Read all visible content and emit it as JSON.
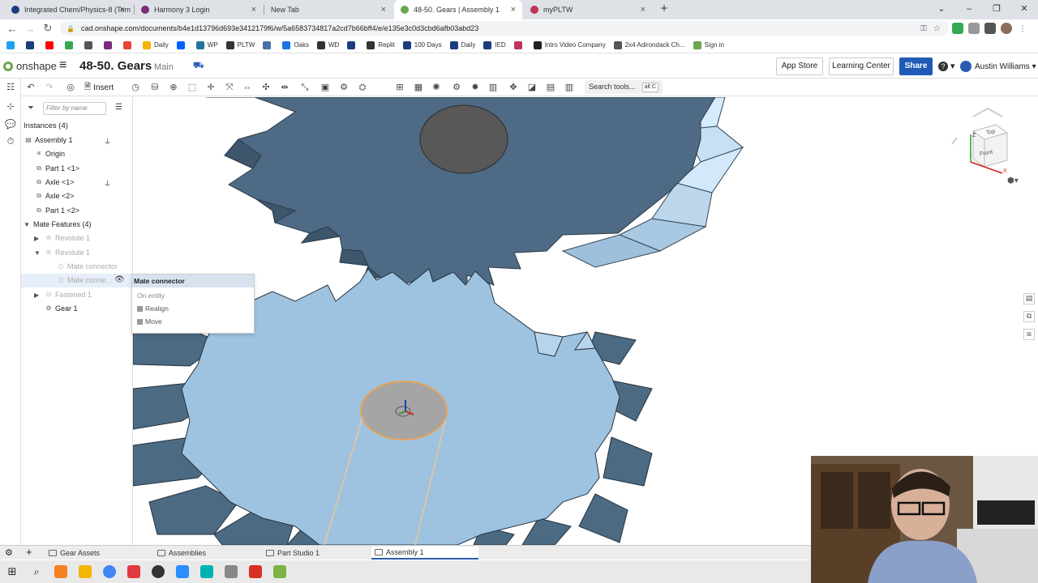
{
  "browser": {
    "tabs": [
      {
        "title": "Integrated Chem/Physics-8 (Tem",
        "color": "#1a3d7c"
      },
      {
        "title": "Harmony 3 Login",
        "color": "#7a2b7c"
      },
      {
        "title": "New Tab",
        "color": ""
      },
      {
        "title": "48-50. Gears | Assembly 1",
        "color": "#6aa84f"
      },
      {
        "title": "myPLTW",
        "color": "#c0335a"
      }
    ],
    "new_tab": "+",
    "url": "cad.onshape.com/documents/b4e1d13796d693e3412179f6/w/5a6583734817a2cd7b66bff4/e/e135e3c0d3cbd6afb03abd23"
  },
  "bookmarks": [
    {
      "label": "",
      "color": "#1da1f2"
    },
    {
      "label": "",
      "color": "#1a3d7c"
    },
    {
      "label": "",
      "color": "#ff0000"
    },
    {
      "label": "",
      "color": "#34a853"
    },
    {
      "label": "",
      "color": "#555555"
    },
    {
      "label": "",
      "color": "#7a2b7c"
    },
    {
      "label": "",
      "color": "#ea4335"
    },
    {
      "label": "Daily",
      "color": "#f4b400"
    },
    {
      "label": "",
      "color": "#0061ff"
    },
    {
      "label": "WP",
      "color": "#21759b"
    },
    {
      "label": "PLTW",
      "color": "#333333"
    },
    {
      "label": "",
      "color": "#4a6fa5"
    },
    {
      "label": "Oaks",
      "color": "#1a73e8"
    },
    {
      "label": "WD",
      "color": "#333333"
    },
    {
      "label": "",
      "color": "#1a3d7c"
    },
    {
      "label": "Replit",
      "color": "#333333"
    },
    {
      "label": "100 Days",
      "color": "#1a3d7c"
    },
    {
      "label": "Daily",
      "color": "#1a3d7c"
    },
    {
      "label": "IED",
      "color": "#1a3d7c"
    },
    {
      "label": "",
      "color": "#c0335a"
    },
    {
      "label": "Intro Video Company",
      "color": "#222222"
    },
    {
      "label": "2x4 Adirondack Ch...",
      "color": "#555555"
    },
    {
      "label": "Sign in",
      "color": "#6aa84f"
    }
  ],
  "onshape": {
    "logo": "onshape",
    "doc_title": "48-50. Gears",
    "branch": "Main",
    "app_store": "App Store",
    "learning_center": "Learning Center",
    "share": "Share",
    "help": "?",
    "user": "Austin Williams"
  },
  "toolbar": {
    "insert": "Insert",
    "search_placeholder": "Search tools...",
    "search_shortcut": "alt C"
  },
  "panel": {
    "filter_placeholder": "Filter by name",
    "instances_header": "Instances (4)",
    "assembly": "Assembly 1",
    "origin": "Origin",
    "items": [
      "Part 1 <1>",
      "Axle <1>",
      "Axle <2>",
      "Part 1 <2>"
    ],
    "mate_features": "Mate Features (4)",
    "revolute1": "Revolute 1",
    "revolute2": "Revolute 1",
    "mate_connector": "Mate connector",
    "mate_connector_trunc": "Mate conne...",
    "fastened": "Fastened 1",
    "gear": "Gear 1"
  },
  "context_menu": {
    "title": "Mate connector",
    "subtitle": "On entity",
    "items": [
      "Realign",
      "Move"
    ]
  },
  "viewcube": {
    "top": "Top",
    "front": "Front",
    "z": "Z",
    "x": "X"
  },
  "doc_tabs": [
    "Gear Assets",
    "Assemblies",
    "Part Studio 1",
    "Assembly 1"
  ],
  "colors": {
    "gear_top": "#4e6a84",
    "gear_top_light": "#c8e0f4",
    "gear_bottom": "#9ec3e0",
    "gear_bottom_dark": "#4c6a82",
    "hole_dark": "#555555",
    "hole_selected": "#e8a35a",
    "share_blue": "#1f5bb5"
  }
}
